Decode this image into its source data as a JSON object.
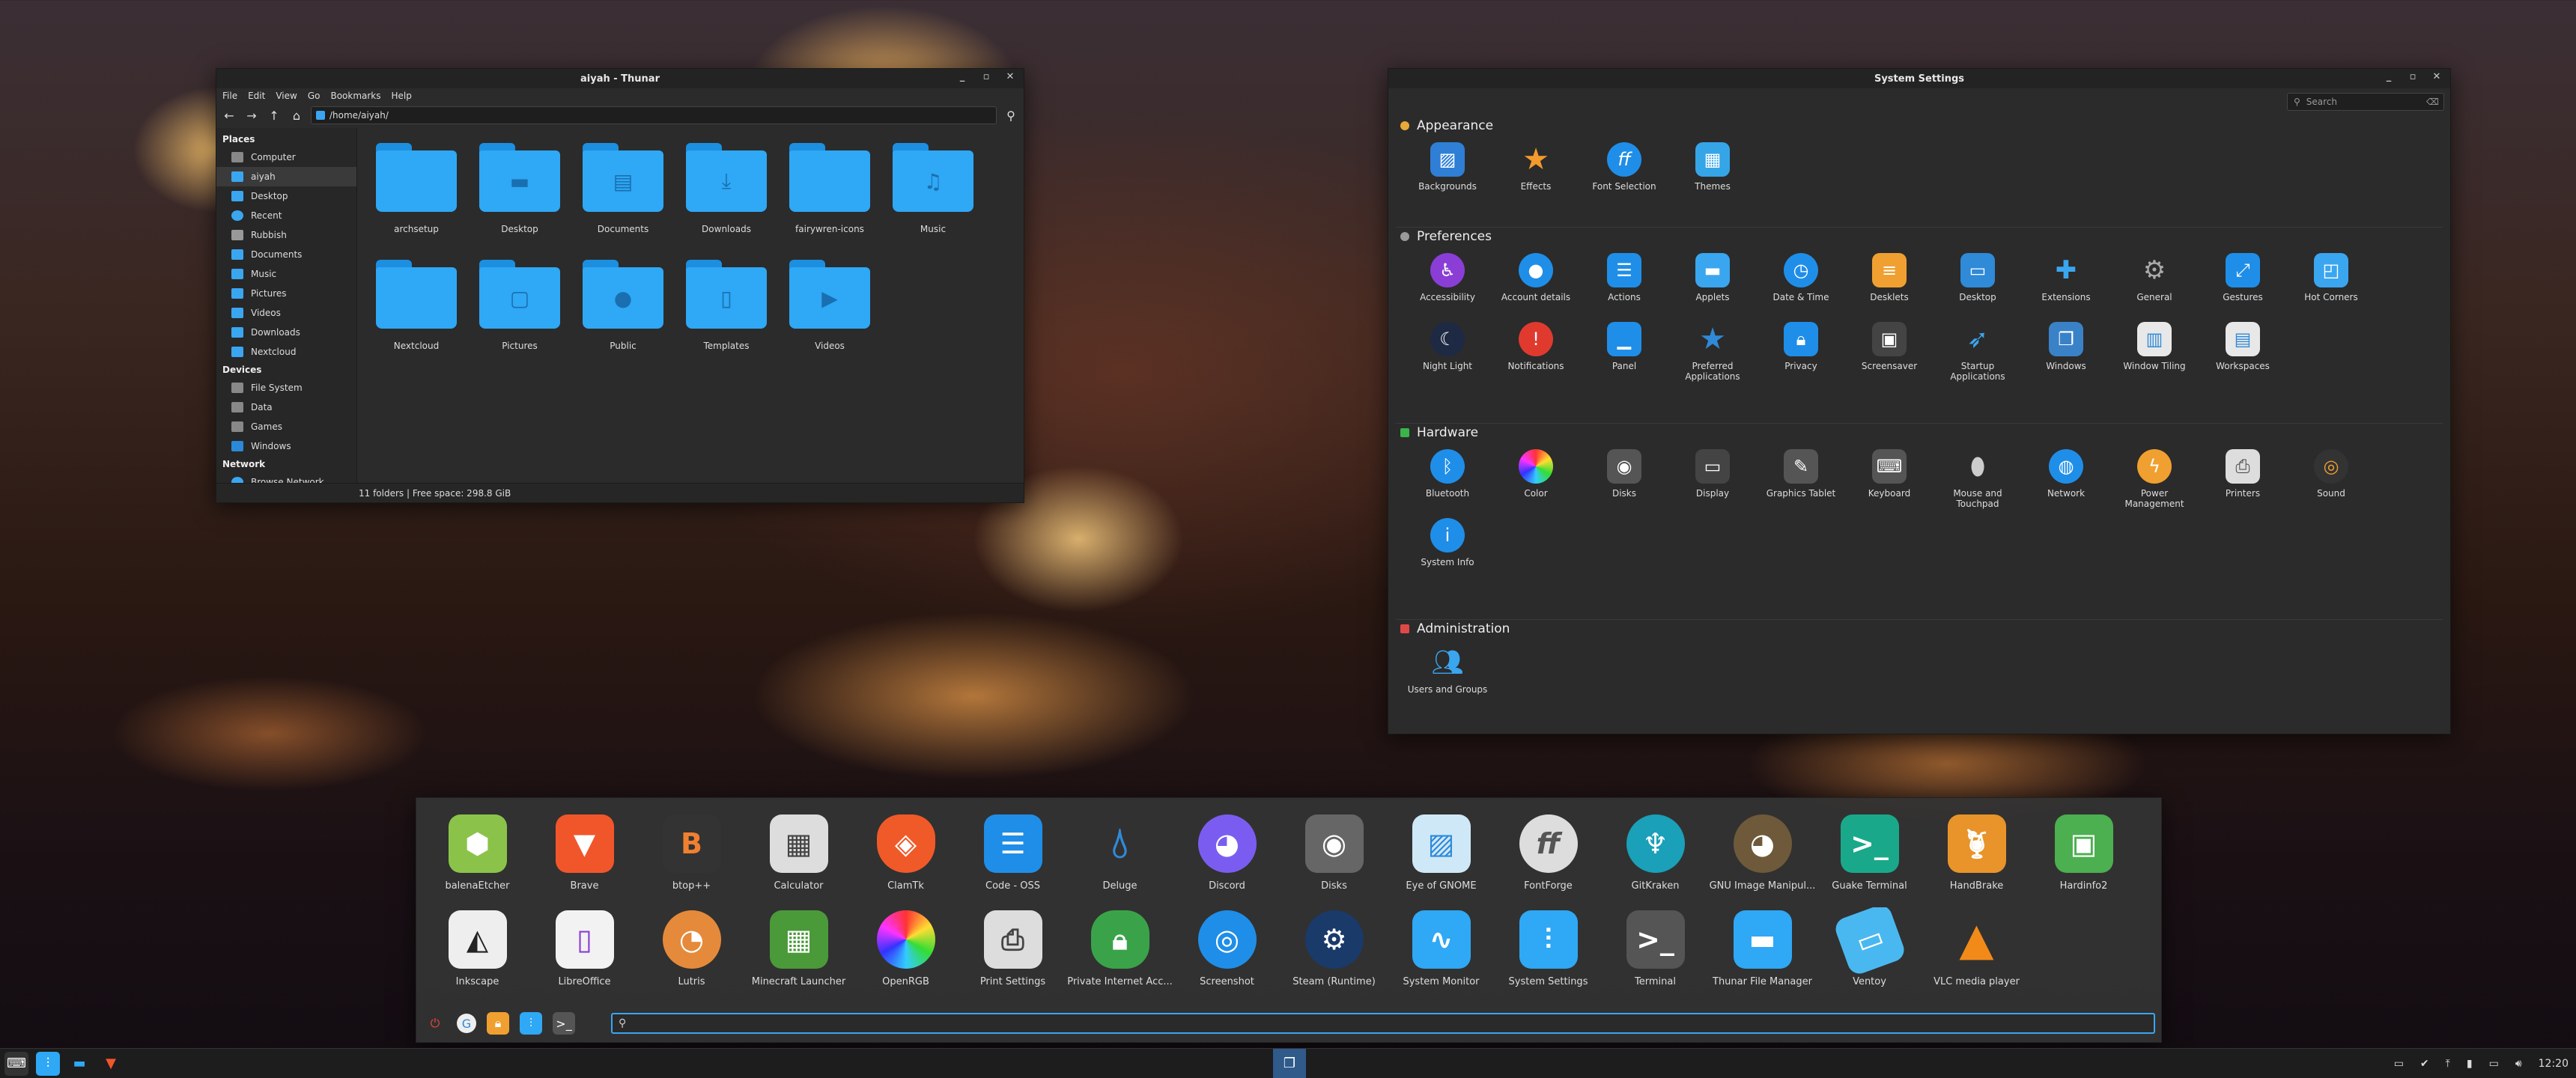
{
  "thunar": {
    "title": "aiyah - Thunar",
    "menu": [
      "File",
      "Edit",
      "View",
      "Go",
      "Bookmarks",
      "Help"
    ],
    "path": "/home/aiyah/",
    "places_head": "Places",
    "places": [
      "Computer",
      "aiyah",
      "Desktop",
      "Recent",
      "Rubbish",
      "Documents",
      "Music",
      "Pictures",
      "Videos",
      "Downloads",
      "Nextcloud"
    ],
    "devices_head": "Devices",
    "devices": [
      "File System",
      "Data",
      "Games",
      "Windows"
    ],
    "network_head": "Network",
    "network": [
      "Browse Network"
    ],
    "folders": [
      "archsetup",
      "Desktop",
      "Documents",
      "Downloads",
      "fairywren-icons",
      "Music",
      "Nextcloud",
      "Pictures",
      "Public",
      "Templates",
      "Videos"
    ],
    "status": "11 folders  |  Free space: 298.8 GiB"
  },
  "settings": {
    "title": "System Settings",
    "search_placeholder": "Search",
    "appearance": {
      "head": "Appearance",
      "items": [
        "Backgrounds",
        "Effects",
        "Font Selection",
        "Themes"
      ]
    },
    "preferences": {
      "head": "Preferences",
      "items": [
        "Accessibility",
        "Account details",
        "Actions",
        "Applets",
        "Date & Time",
        "Desklets",
        "Desktop",
        "Extensions",
        "General",
        "Gestures",
        "Hot Corners",
        "Night Light",
        "Notifications",
        "Panel",
        "Preferred Applications",
        "Privacy",
        "Screensaver",
        "Startup Applications",
        "Windows",
        "Window Tiling",
        "Workspaces"
      ]
    },
    "hardware": {
      "head": "Hardware",
      "items": [
        "Bluetooth",
        "Color",
        "Disks",
        "Display",
        "Graphics Tablet",
        "Keyboard",
        "Mouse and Touchpad",
        "Network",
        "Power Management",
        "Printers",
        "Sound",
        "System Info"
      ]
    },
    "administration": {
      "head": "Administration",
      "items": [
        "Users and Groups"
      ]
    }
  },
  "launcher": {
    "apps": [
      "balenaEtcher",
      "Brave",
      "btop++",
      "Calculator",
      "ClamTk",
      "Code - OSS",
      "Deluge",
      "Discord",
      "Disks",
      "Eye of GNOME",
      "FontForge",
      "GitKraken",
      "GNU Image Manipul...",
      "Guake Terminal",
      "HandBrake",
      "Hardinfo2",
      "Inkscape",
      "LibreOffice",
      "Lutris",
      "Minecraft Launcher",
      "OpenRGB",
      "Print Settings",
      "Private Internet Acc...",
      "Screenshot",
      "Steam (Runtime)",
      "System Monitor",
      "System Settings",
      "Terminal",
      "Thunar File Manager",
      "Ventoy",
      "VLC media player"
    ]
  },
  "panel": {
    "clock": "12:20"
  }
}
